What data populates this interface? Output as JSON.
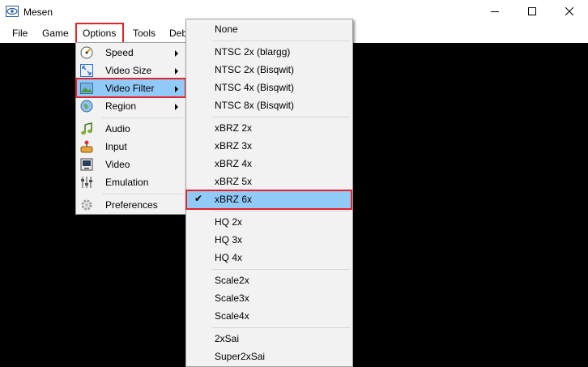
{
  "window": {
    "title": "Mesen",
    "controls": [
      "minimize",
      "maximize",
      "close"
    ]
  },
  "menubar": {
    "items": [
      "File",
      "Game",
      "Options",
      "Tools",
      "Deb"
    ]
  },
  "options_menu": {
    "items": [
      {
        "label": "Speed",
        "icon": "speed-icon",
        "submenu": true
      },
      {
        "label": "Video Size",
        "icon": "video-size-icon",
        "submenu": true
      },
      {
        "label": "Video Filter",
        "icon": "video-filter-icon",
        "submenu": true,
        "highlighted": true
      },
      {
        "label": "Region",
        "icon": "globe-icon",
        "submenu": true
      },
      {
        "label": "Audio",
        "icon": "audio-icon"
      },
      {
        "label": "Input",
        "icon": "input-icon"
      },
      {
        "label": "Video",
        "icon": "video-icon"
      },
      {
        "label": "Emulation",
        "icon": "emulation-icon"
      },
      {
        "label": "Preferences",
        "icon": "gear-icon"
      }
    ]
  },
  "video_filter_menu": {
    "items": [
      {
        "label": "None"
      },
      {
        "label": "NTSC 2x (blargg)"
      },
      {
        "label": "NTSC 2x (Bisqwit)"
      },
      {
        "label": "NTSC 4x (Bisqwit)"
      },
      {
        "label": "NTSC 8x (Bisqwit)"
      },
      {
        "label": "xBRZ 2x"
      },
      {
        "label": "xBRZ 3x"
      },
      {
        "label": "xBRZ 4x"
      },
      {
        "label": "xBRZ 5x"
      },
      {
        "label": "xBRZ 6x",
        "checked": true,
        "highlighted": true
      },
      {
        "label": "HQ 2x"
      },
      {
        "label": "HQ 3x"
      },
      {
        "label": "HQ 4x"
      },
      {
        "label": "Scale2x"
      },
      {
        "label": "Scale3x"
      },
      {
        "label": "Scale4x"
      },
      {
        "label": "2xSai"
      },
      {
        "label": "Super2xSai"
      }
    ],
    "check_glyph": "✔"
  },
  "colors": {
    "highlight": "#91c9f7",
    "annotation_box": "#e0242a",
    "menu_bg": "#f2f2f2"
  }
}
